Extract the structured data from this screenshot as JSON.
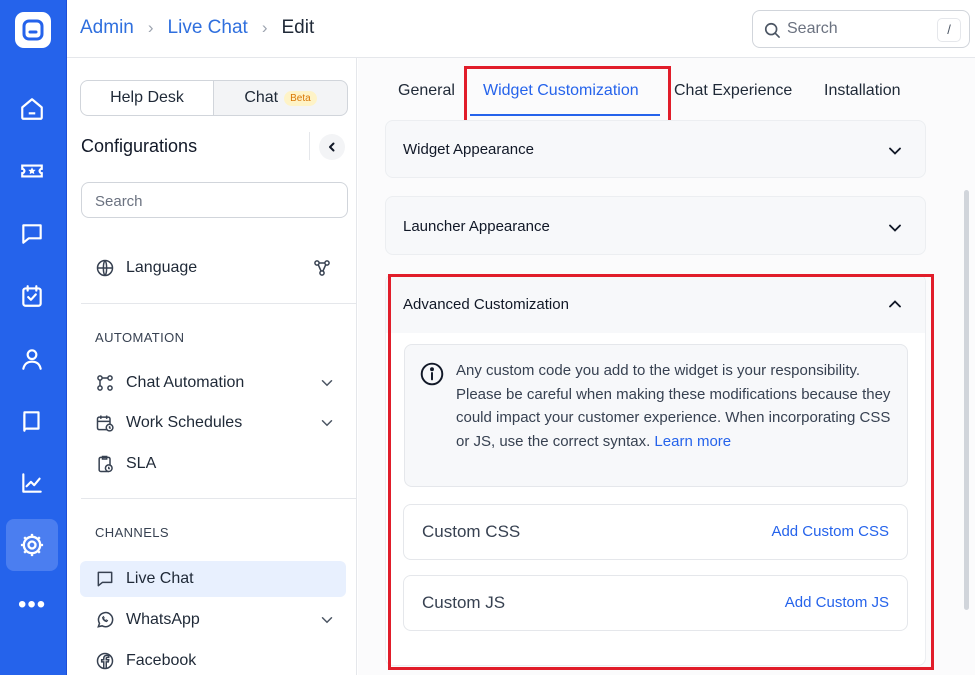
{
  "rail": {
    "icons": [
      "logo-icon",
      "home-icon",
      "tickets-icon",
      "chat-icon",
      "tasks-icon",
      "contacts-icon",
      "knowledge-base-icon",
      "analytics-icon",
      "settings-icon",
      "more-icon"
    ],
    "more_glyph": "•••",
    "accent": "#2563eb"
  },
  "header": {
    "breadcrumb": [
      "Admin",
      "Live Chat",
      "Edit"
    ],
    "search_placeholder": "Search",
    "search_shortcut": "/"
  },
  "config": {
    "toggle": {
      "help_desk": "Help Desk",
      "chat": "Chat",
      "chat_badge": "Beta"
    },
    "title": "Configurations",
    "search_placeholder": "Search",
    "language": "Language",
    "automation_label": "AUTOMATION",
    "automation_items": [
      "Chat Automation",
      "Work Schedules",
      "SLA"
    ],
    "channels_label": "CHANNELS",
    "channel_items": [
      "Live Chat",
      "WhatsApp",
      "Facebook"
    ]
  },
  "main": {
    "tabs": [
      "General",
      "Widget Customization",
      "Chat Experience",
      "Installation"
    ],
    "active_tab": "Widget Customization",
    "sections": {
      "widget_appearance": "Widget Appearance",
      "launcher_appearance": "Launcher Appearance",
      "advanced_customization": "Advanced Customization"
    },
    "notice": {
      "text": "Any custom code you add to the widget is your responsibility. Please be careful when making these modifications because they could impact your customer experience. When incorporating CSS or JS, use the correct syntax.",
      "link": "Learn more"
    },
    "custom_css": {
      "label": "Custom CSS",
      "action": "Add Custom CSS"
    },
    "custom_js": {
      "label": "Custom JS",
      "action": "Add Custom JS"
    },
    "highlight_color": "#e11d2a"
  }
}
